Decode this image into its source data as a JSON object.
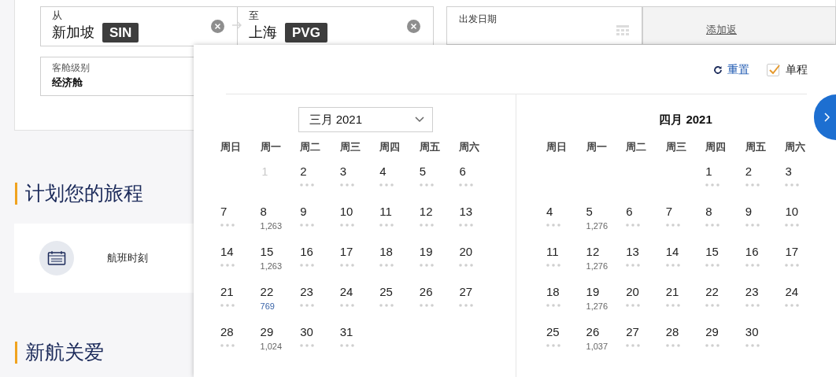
{
  "search_form": {
    "origin": {
      "label": "从",
      "city": "新加坡",
      "code": "SIN"
    },
    "destination": {
      "label": "至",
      "city": "上海",
      "code": "PVG"
    },
    "departure_date": {
      "label": "出发日期"
    },
    "return_link": "添加返",
    "cabin": {
      "label": "客舱级别",
      "value": "经济舱"
    }
  },
  "sections": [
    {
      "title": "计划您的旅程",
      "items": [
        {
          "label": "航班时刻"
        }
      ]
    },
    {
      "title": "新航关爱"
    }
  ],
  "calendar": {
    "reset": "重置",
    "one_way": {
      "label": "单程",
      "checked": true
    },
    "months": [
      {
        "title": "三月 2021",
        "dropdown": true,
        "weekdays": [
          "周日",
          "周一",
          "周二",
          "周三",
          "周四",
          "周五",
          "周六"
        ],
        "weeks": [
          [
            {
              "kind": "blank"
            },
            {
              "kind": "disabled",
              "day": "1"
            },
            {
              "kind": "dots",
              "day": "2"
            },
            {
              "kind": "dots",
              "day": "3"
            },
            {
              "kind": "dots",
              "day": "4"
            },
            {
              "kind": "dots",
              "day": "5"
            },
            {
              "kind": "dots",
              "day": "6"
            }
          ],
          [
            {
              "kind": "dots",
              "day": "7"
            },
            {
              "kind": "price",
              "day": "8",
              "price": "1,263",
              "lowest": false
            },
            {
              "kind": "dots",
              "day": "9"
            },
            {
              "kind": "dots",
              "day": "10"
            },
            {
              "kind": "dots",
              "day": "11"
            },
            {
              "kind": "dots",
              "day": "12"
            },
            {
              "kind": "dots",
              "day": "13"
            }
          ],
          [
            {
              "kind": "dots",
              "day": "14"
            },
            {
              "kind": "price",
              "day": "15",
              "price": "1,263",
              "lowest": false
            },
            {
              "kind": "dots",
              "day": "16"
            },
            {
              "kind": "dots",
              "day": "17"
            },
            {
              "kind": "dots",
              "day": "18"
            },
            {
              "kind": "dots",
              "day": "19"
            },
            {
              "kind": "dots",
              "day": "20"
            }
          ],
          [
            {
              "kind": "dots",
              "day": "21"
            },
            {
              "kind": "price",
              "day": "22",
              "price": "769",
              "lowest": true
            },
            {
              "kind": "dots",
              "day": "23"
            },
            {
              "kind": "dots",
              "day": "24"
            },
            {
              "kind": "dots",
              "day": "25"
            },
            {
              "kind": "dots",
              "day": "26"
            },
            {
              "kind": "dots",
              "day": "27"
            }
          ],
          [
            {
              "kind": "dots",
              "day": "28"
            },
            {
              "kind": "price",
              "day": "29",
              "price": "1,024",
              "lowest": false
            },
            {
              "kind": "dots",
              "day": "30"
            },
            {
              "kind": "dots",
              "day": "31"
            }
          ]
        ]
      },
      {
        "title": "四月 2021",
        "dropdown": false,
        "weekdays": [
          "周日",
          "周一",
          "周二",
          "周三",
          "周四",
          "周五",
          "周六"
        ],
        "weeks": [
          [
            {
              "kind": "blank"
            },
            {
              "kind": "blank"
            },
            {
              "kind": "blank"
            },
            {
              "kind": "blank"
            },
            {
              "kind": "dots",
              "day": "1"
            },
            {
              "kind": "dots",
              "day": "2"
            },
            {
              "kind": "dots",
              "day": "3"
            }
          ],
          [
            {
              "kind": "dots",
              "day": "4"
            },
            {
              "kind": "price",
              "day": "5",
              "price": "1,276",
              "lowest": false
            },
            {
              "kind": "dots",
              "day": "6"
            },
            {
              "kind": "dots",
              "day": "7"
            },
            {
              "kind": "dots",
              "day": "8"
            },
            {
              "kind": "dots",
              "day": "9"
            },
            {
              "kind": "dots",
              "day": "10"
            }
          ],
          [
            {
              "kind": "dots",
              "day": "11"
            },
            {
              "kind": "price",
              "day": "12",
              "price": "1,276",
              "lowest": false
            },
            {
              "kind": "dots",
              "day": "13"
            },
            {
              "kind": "dots",
              "day": "14"
            },
            {
              "kind": "dots",
              "day": "15"
            },
            {
              "kind": "dots",
              "day": "16"
            },
            {
              "kind": "dots",
              "day": "17"
            }
          ],
          [
            {
              "kind": "dots",
              "day": "18"
            },
            {
              "kind": "price",
              "day": "19",
              "price": "1,276",
              "lowest": false
            },
            {
              "kind": "dots",
              "day": "20"
            },
            {
              "kind": "dots",
              "day": "21"
            },
            {
              "kind": "dots",
              "day": "22"
            },
            {
              "kind": "dots",
              "day": "23"
            },
            {
              "kind": "dots",
              "day": "24"
            }
          ],
          [
            {
              "kind": "dots",
              "day": "25"
            },
            {
              "kind": "price",
              "day": "26",
              "price": "1,037",
              "lowest": false
            },
            {
              "kind": "dots",
              "day": "27"
            },
            {
              "kind": "dots",
              "day": "28"
            },
            {
              "kind": "dots",
              "day": "29"
            },
            {
              "kind": "dots",
              "day": "30"
            }
          ]
        ]
      }
    ]
  }
}
